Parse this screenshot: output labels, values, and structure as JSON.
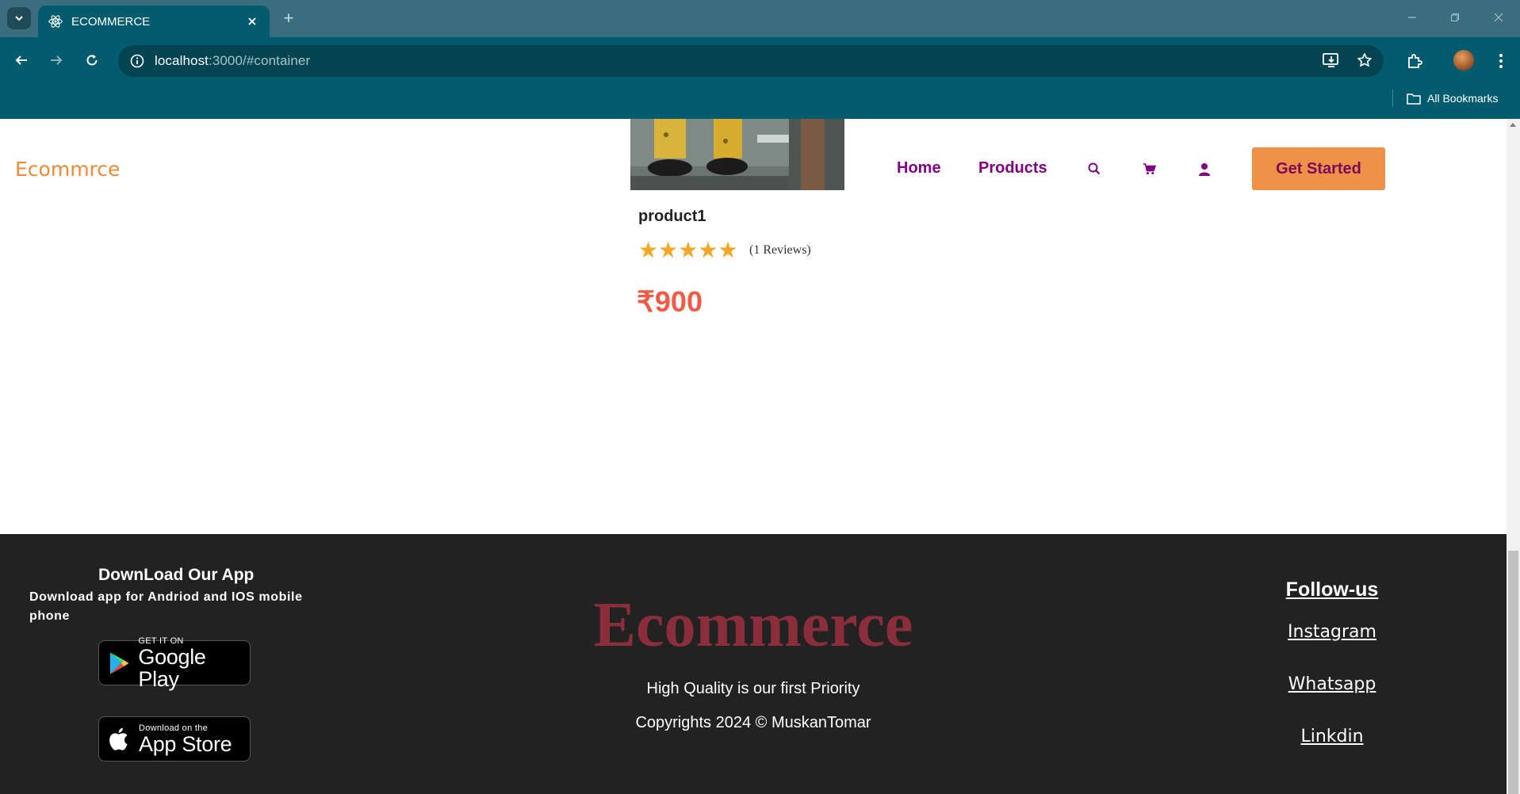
{
  "browser": {
    "tab_title": "ECOMMERCE",
    "url_host": "localhost",
    "url_rest": ":3000/#container",
    "bookmarks_label": "All Bookmarks"
  },
  "header": {
    "brand": "Ecommrce",
    "nav": {
      "home": "Home",
      "products": "Products"
    },
    "cta": "Get Started"
  },
  "product": {
    "name": "product1",
    "rating": 5,
    "rating_max": 5,
    "reviews": "(1 Reviews)",
    "price": "₹900"
  },
  "footer": {
    "download_title": "DownLoad Our App",
    "download_desc": "Download app for Andriod and IOS mobile phone",
    "google_play": {
      "small": "GET IT ON",
      "big": "Google Play"
    },
    "app_store": {
      "small": "Download on the",
      "big": "App Store"
    },
    "brand": "Ecommerce",
    "tagline": "High Quality is our first Priority",
    "copyright": "Copyrights 2024 © MuskanTomar",
    "follow_title": "Follow-us",
    "social": [
      "Instagram",
      "Whatsapp",
      "Linkdin"
    ]
  },
  "colors": {
    "brand_orange": "#ef8a35",
    "nav_purple": "#800080",
    "cta_bg": "#ef9147",
    "price_red": "#f15a44",
    "star": "#f5a623",
    "footer_bg": "#222222",
    "footer_brand": "#8b2e3b"
  }
}
